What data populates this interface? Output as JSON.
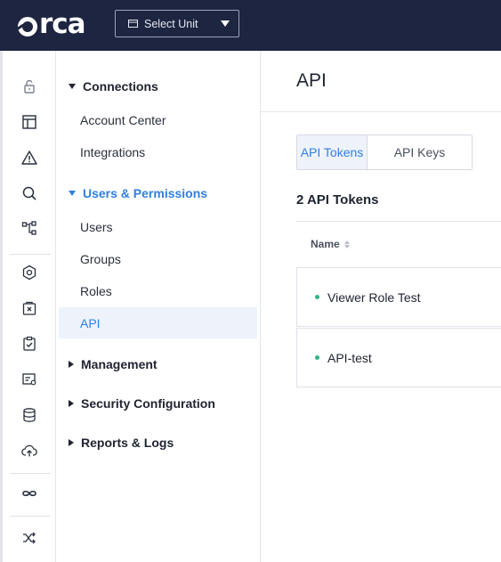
{
  "header": {
    "logo_text": "rca",
    "unit_select": {
      "label": "Select Unit"
    }
  },
  "rail": {
    "icons": [
      "unlock-icon",
      "dashboard-icon",
      "alert-icon",
      "search-icon",
      "graph-icon",
      "risk-icon",
      "vulnerability-icon",
      "compliance-icon",
      "inventory-icon",
      "database-icon",
      "cloud-upload-icon",
      "integrations-icon",
      "shuffle-icon"
    ]
  },
  "nav": {
    "sections": [
      {
        "label": "Connections",
        "expanded": true
      },
      {
        "label": "Users & Permissions",
        "expanded": true
      },
      {
        "label": "Management",
        "expanded": false
      },
      {
        "label": "Security Configuration",
        "expanded": false
      },
      {
        "label": "Reports & Logs",
        "expanded": false
      }
    ],
    "connections_items": [
      "Account Center",
      "Integrations"
    ],
    "users_items": [
      "Users",
      "Groups",
      "Roles",
      "API"
    ],
    "selected": "API"
  },
  "main": {
    "title": "API",
    "tabs": [
      {
        "label": "API Tokens",
        "active": true
      },
      {
        "label": "API Keys",
        "active": false
      }
    ],
    "count_label": "2 API Tokens",
    "columns": [
      "Name"
    ],
    "rows": [
      {
        "name": "Viewer Role Test",
        "status_color": "#2fb58a"
      },
      {
        "name": "API-test",
        "status_color": "#2fb58a"
      }
    ]
  },
  "colors": {
    "topbar": "#1d2540",
    "accent": "#2f7fe0",
    "status_active": "#2fb58a"
  }
}
